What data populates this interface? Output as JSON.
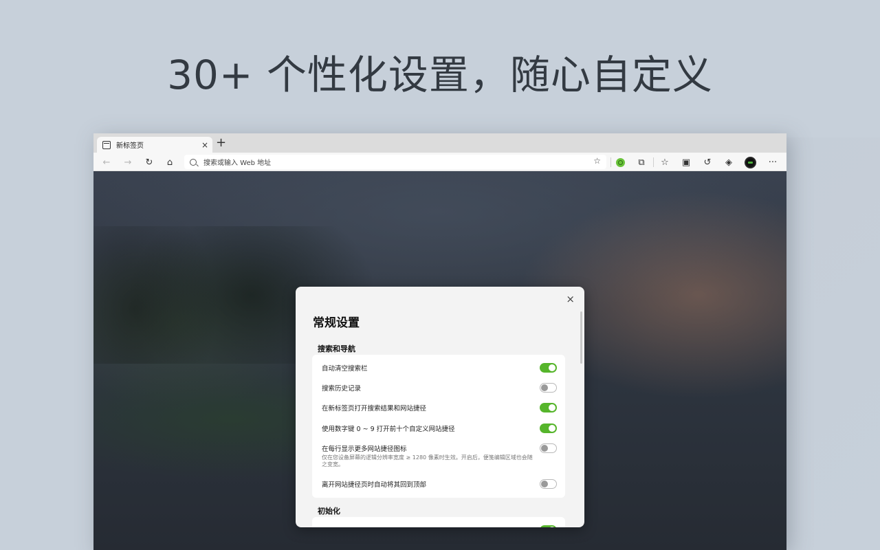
{
  "headline": "30+ 个性化设置，随心自定义",
  "browser": {
    "tab_title": "新标签页",
    "tab_close": "×",
    "new_tab": "+",
    "address_placeholder": "搜索或输入 Web 地址",
    "buttons": {
      "back": "←",
      "forward": "→",
      "reload": "↻",
      "home": "⌂",
      "favorite_add": "☆",
      "extensions": "⧉",
      "favorites": "☆",
      "collections": "▣",
      "history": "↺",
      "performance": "◈",
      "more": "···"
    }
  },
  "dialog": {
    "close": "×",
    "title": "常规设置",
    "sections": [
      {
        "label": "搜索和导航",
        "items": [
          {
            "label": "自动清空搜索栏",
            "on": true
          },
          {
            "label": "搜索历史记录",
            "on": false
          },
          {
            "label": "在新标签页打开搜索结果和网站捷径",
            "on": true
          },
          {
            "label": "使用数字键 0 ~ 9 打开前十个自定义网站捷径",
            "on": true
          },
          {
            "label": "在每行显示更多网站捷径图标",
            "desc": "仅在您设备屏幕的逻辑分辨率宽度 ≥ 1280 像素时生效。开启后，便笺编辑区域也会随之变宽。",
            "on": false
          },
          {
            "label": "离开网站捷径页时自动将其回到顶部",
            "on": false
          }
        ]
      },
      {
        "label": "初始化",
        "items": [
          {
            "label": "",
            "on": true
          }
        ]
      }
    ]
  },
  "colors": {
    "toggle_on": "#56b52b",
    "background": "#c7d0da"
  }
}
